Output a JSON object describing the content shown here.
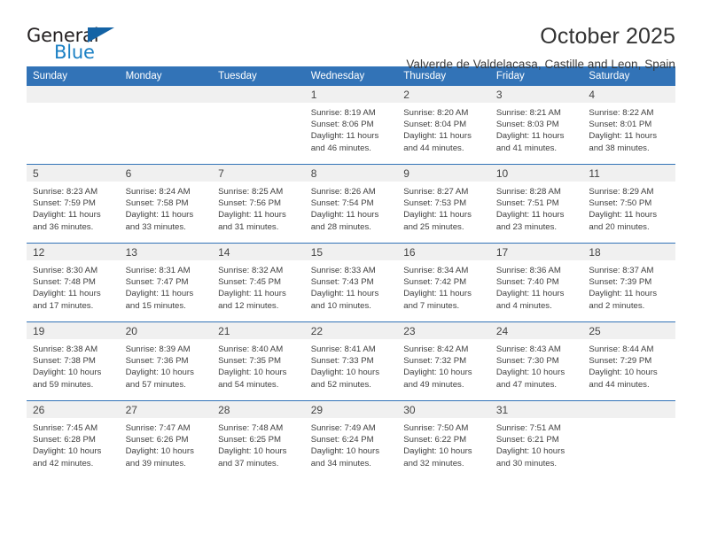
{
  "logo": {
    "text_top": "General",
    "text_bottom": "Blue",
    "triangle_color": "#1463a5",
    "blue_color": "#1b80c4"
  },
  "header": {
    "title": "October 2025",
    "subtitle": "Valverde de Valdelacasa, Castille and Leon, Spain"
  },
  "theme": {
    "header_bg": "#3273b7",
    "daynum_bg": "#f0f0f0",
    "text": "#3f3f3f"
  },
  "weekday_headers": [
    "Sunday",
    "Monday",
    "Tuesday",
    "Wednesday",
    "Thursday",
    "Friday",
    "Saturday"
  ],
  "weeks": [
    [
      {
        "day": "",
        "empty": true
      },
      {
        "day": "",
        "empty": true
      },
      {
        "day": "",
        "empty": true
      },
      {
        "day": "1",
        "sunrise": "Sunrise: 8:19 AM",
        "sunset": "Sunset: 8:06 PM",
        "daylight1": "Daylight: 11 hours",
        "daylight2": "and 46 minutes."
      },
      {
        "day": "2",
        "sunrise": "Sunrise: 8:20 AM",
        "sunset": "Sunset: 8:04 PM",
        "daylight1": "Daylight: 11 hours",
        "daylight2": "and 44 minutes."
      },
      {
        "day": "3",
        "sunrise": "Sunrise: 8:21 AM",
        "sunset": "Sunset: 8:03 PM",
        "daylight1": "Daylight: 11 hours",
        "daylight2": "and 41 minutes."
      },
      {
        "day": "4",
        "sunrise": "Sunrise: 8:22 AM",
        "sunset": "Sunset: 8:01 PM",
        "daylight1": "Daylight: 11 hours",
        "daylight2": "and 38 minutes."
      }
    ],
    [
      {
        "day": "5",
        "sunrise": "Sunrise: 8:23 AM",
        "sunset": "Sunset: 7:59 PM",
        "daylight1": "Daylight: 11 hours",
        "daylight2": "and 36 minutes."
      },
      {
        "day": "6",
        "sunrise": "Sunrise: 8:24 AM",
        "sunset": "Sunset: 7:58 PM",
        "daylight1": "Daylight: 11 hours",
        "daylight2": "and 33 minutes."
      },
      {
        "day": "7",
        "sunrise": "Sunrise: 8:25 AM",
        "sunset": "Sunset: 7:56 PM",
        "daylight1": "Daylight: 11 hours",
        "daylight2": "and 31 minutes."
      },
      {
        "day": "8",
        "sunrise": "Sunrise: 8:26 AM",
        "sunset": "Sunset: 7:54 PM",
        "daylight1": "Daylight: 11 hours",
        "daylight2": "and 28 minutes."
      },
      {
        "day": "9",
        "sunrise": "Sunrise: 8:27 AM",
        "sunset": "Sunset: 7:53 PM",
        "daylight1": "Daylight: 11 hours",
        "daylight2": "and 25 minutes."
      },
      {
        "day": "10",
        "sunrise": "Sunrise: 8:28 AM",
        "sunset": "Sunset: 7:51 PM",
        "daylight1": "Daylight: 11 hours",
        "daylight2": "and 23 minutes."
      },
      {
        "day": "11",
        "sunrise": "Sunrise: 8:29 AM",
        "sunset": "Sunset: 7:50 PM",
        "daylight1": "Daylight: 11 hours",
        "daylight2": "and 20 minutes."
      }
    ],
    [
      {
        "day": "12",
        "sunrise": "Sunrise: 8:30 AM",
        "sunset": "Sunset: 7:48 PM",
        "daylight1": "Daylight: 11 hours",
        "daylight2": "and 17 minutes."
      },
      {
        "day": "13",
        "sunrise": "Sunrise: 8:31 AM",
        "sunset": "Sunset: 7:47 PM",
        "daylight1": "Daylight: 11 hours",
        "daylight2": "and 15 minutes."
      },
      {
        "day": "14",
        "sunrise": "Sunrise: 8:32 AM",
        "sunset": "Sunset: 7:45 PM",
        "daylight1": "Daylight: 11 hours",
        "daylight2": "and 12 minutes."
      },
      {
        "day": "15",
        "sunrise": "Sunrise: 8:33 AM",
        "sunset": "Sunset: 7:43 PM",
        "daylight1": "Daylight: 11 hours",
        "daylight2": "and 10 minutes."
      },
      {
        "day": "16",
        "sunrise": "Sunrise: 8:34 AM",
        "sunset": "Sunset: 7:42 PM",
        "daylight1": "Daylight: 11 hours",
        "daylight2": "and 7 minutes."
      },
      {
        "day": "17",
        "sunrise": "Sunrise: 8:36 AM",
        "sunset": "Sunset: 7:40 PM",
        "daylight1": "Daylight: 11 hours",
        "daylight2": "and 4 minutes."
      },
      {
        "day": "18",
        "sunrise": "Sunrise: 8:37 AM",
        "sunset": "Sunset: 7:39 PM",
        "daylight1": "Daylight: 11 hours",
        "daylight2": "and 2 minutes."
      }
    ],
    [
      {
        "day": "19",
        "sunrise": "Sunrise: 8:38 AM",
        "sunset": "Sunset: 7:38 PM",
        "daylight1": "Daylight: 10 hours",
        "daylight2": "and 59 minutes."
      },
      {
        "day": "20",
        "sunrise": "Sunrise: 8:39 AM",
        "sunset": "Sunset: 7:36 PM",
        "daylight1": "Daylight: 10 hours",
        "daylight2": "and 57 minutes."
      },
      {
        "day": "21",
        "sunrise": "Sunrise: 8:40 AM",
        "sunset": "Sunset: 7:35 PM",
        "daylight1": "Daylight: 10 hours",
        "daylight2": "and 54 minutes."
      },
      {
        "day": "22",
        "sunrise": "Sunrise: 8:41 AM",
        "sunset": "Sunset: 7:33 PM",
        "daylight1": "Daylight: 10 hours",
        "daylight2": "and 52 minutes."
      },
      {
        "day": "23",
        "sunrise": "Sunrise: 8:42 AM",
        "sunset": "Sunset: 7:32 PM",
        "daylight1": "Daylight: 10 hours",
        "daylight2": "and 49 minutes."
      },
      {
        "day": "24",
        "sunrise": "Sunrise: 8:43 AM",
        "sunset": "Sunset: 7:30 PM",
        "daylight1": "Daylight: 10 hours",
        "daylight2": "and 47 minutes."
      },
      {
        "day": "25",
        "sunrise": "Sunrise: 8:44 AM",
        "sunset": "Sunset: 7:29 PM",
        "daylight1": "Daylight: 10 hours",
        "daylight2": "and 44 minutes."
      }
    ],
    [
      {
        "day": "26",
        "sunrise": "Sunrise: 7:45 AM",
        "sunset": "Sunset: 6:28 PM",
        "daylight1": "Daylight: 10 hours",
        "daylight2": "and 42 minutes."
      },
      {
        "day": "27",
        "sunrise": "Sunrise: 7:47 AM",
        "sunset": "Sunset: 6:26 PM",
        "daylight1": "Daylight: 10 hours",
        "daylight2": "and 39 minutes."
      },
      {
        "day": "28",
        "sunrise": "Sunrise: 7:48 AM",
        "sunset": "Sunset: 6:25 PM",
        "daylight1": "Daylight: 10 hours",
        "daylight2": "and 37 minutes."
      },
      {
        "day": "29",
        "sunrise": "Sunrise: 7:49 AM",
        "sunset": "Sunset: 6:24 PM",
        "daylight1": "Daylight: 10 hours",
        "daylight2": "and 34 minutes."
      },
      {
        "day": "30",
        "sunrise": "Sunrise: 7:50 AM",
        "sunset": "Sunset: 6:22 PM",
        "daylight1": "Daylight: 10 hours",
        "daylight2": "and 32 minutes."
      },
      {
        "day": "31",
        "sunrise": "Sunrise: 7:51 AM",
        "sunset": "Sunset: 6:21 PM",
        "daylight1": "Daylight: 10 hours",
        "daylight2": "and 30 minutes."
      },
      {
        "day": "",
        "empty": true
      }
    ]
  ]
}
